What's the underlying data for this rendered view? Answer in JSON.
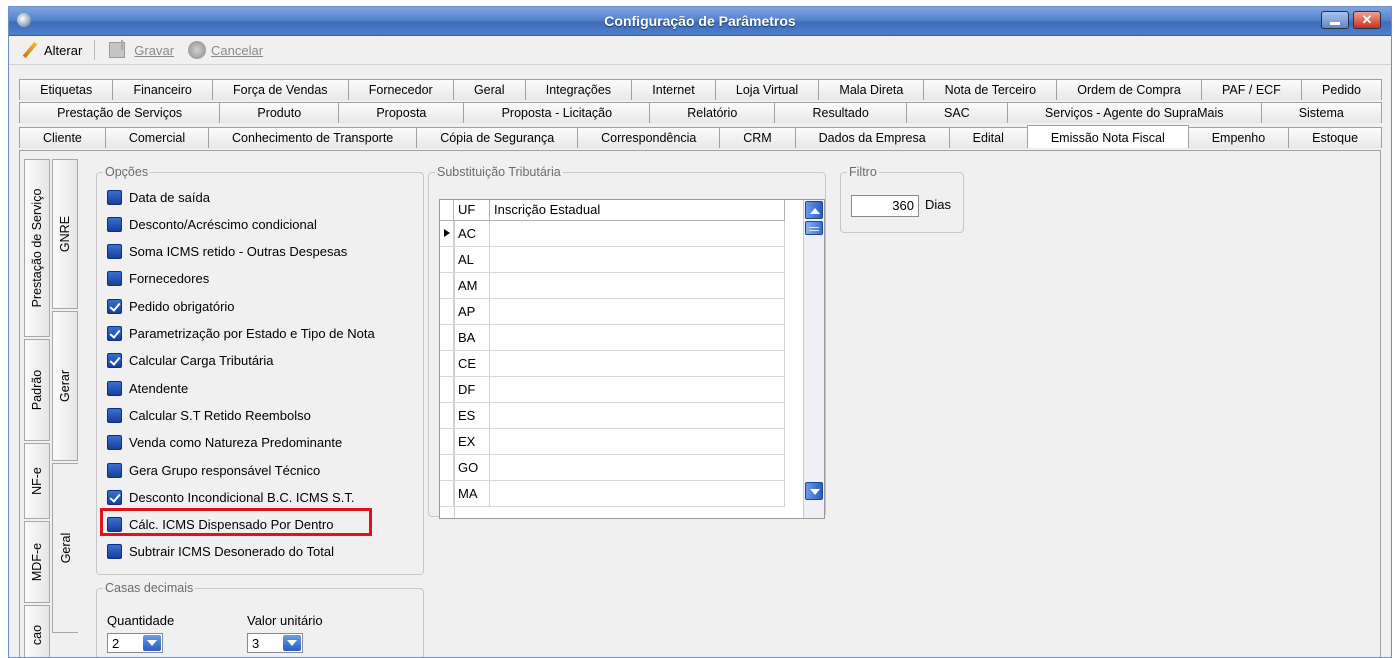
{
  "window": {
    "title": "Configuração de Parâmetros"
  },
  "toolbar": {
    "alterar": "Alterar",
    "gravar": "Gravar",
    "cancelar": "Cancelar"
  },
  "tabs": {
    "row1": [
      "Etiquetas",
      "Financeiro",
      "Força de Vendas",
      "Fornecedor",
      "Geral",
      "Integrações",
      "Internet",
      "Loja Virtual",
      "Mala Direta",
      "Nota de Terceiro",
      "Ordem de Compra",
      "PAF / ECF",
      "Pedido"
    ],
    "row2": [
      "Prestação de Serviços",
      "Produto",
      "Proposta",
      "Proposta - Licitação",
      "Relatório",
      "Resultado",
      "SAC",
      "Serviços - Agente do SupraMais",
      "Sistema"
    ],
    "row3": [
      "Cliente",
      "Comercial",
      "Conhecimento de Transporte",
      "Cópia de Segurança",
      "Correspondência",
      "CRM",
      "Dados da Empresa",
      "Edital",
      "Emissão Nota Fiscal",
      "Empenho",
      "Estoque"
    ],
    "active": "Emissão Nota Fiscal"
  },
  "side_tabs_outer": [
    "Prestação de Serviço",
    "Padrão",
    "NF-e",
    "MDF-e",
    "cao"
  ],
  "side_tabs_inner": [
    "GNRE",
    "Gerar",
    "Geral"
  ],
  "opcoes": {
    "legend": "Opções",
    "items": [
      {
        "label": "Data de saída",
        "checked": false
      },
      {
        "label": "Desconto/Acréscimo condicional",
        "checked": false
      },
      {
        "label": "Soma ICMS retido - Outras Despesas",
        "checked": false
      },
      {
        "label": "Fornecedores",
        "checked": false
      },
      {
        "label": "Pedido obrigatório",
        "checked": true
      },
      {
        "label": "Parametrização por Estado e Tipo de Nota",
        "checked": true
      },
      {
        "label": "Calcular Carga Tributária",
        "checked": true
      },
      {
        "label": "Atendente",
        "checked": false
      },
      {
        "label": "Calcular S.T Retido Reembolso",
        "checked": false
      },
      {
        "label": "Venda como Natureza Predominante",
        "checked": false
      },
      {
        "label": "Gera Grupo responsável Técnico",
        "checked": false
      },
      {
        "label": "Desconto Incondicional B.C. ICMS S.T.",
        "checked": true
      },
      {
        "label": "Cálc. ICMS Dispensado Por Dentro",
        "checked": false
      },
      {
        "label": "Subtrair ICMS Desonerado do Total",
        "checked": false
      }
    ]
  },
  "casas": {
    "legend": "Casas decimais",
    "quantidade_label": "Quantidade",
    "quantidade_value": "2",
    "valor_label": "Valor unitário",
    "valor_value": "3"
  },
  "st": {
    "legend": "Substituição Tributária",
    "col_uf": "UF",
    "col_ie": "Inscrição Estadual",
    "rows": [
      "AC",
      "AL",
      "AM",
      "AP",
      "BA",
      "CE",
      "DF",
      "ES",
      "EX",
      "GO",
      "MA"
    ]
  },
  "filtro": {
    "legend": "Filtro",
    "value": "360",
    "unit": "Dias"
  }
}
